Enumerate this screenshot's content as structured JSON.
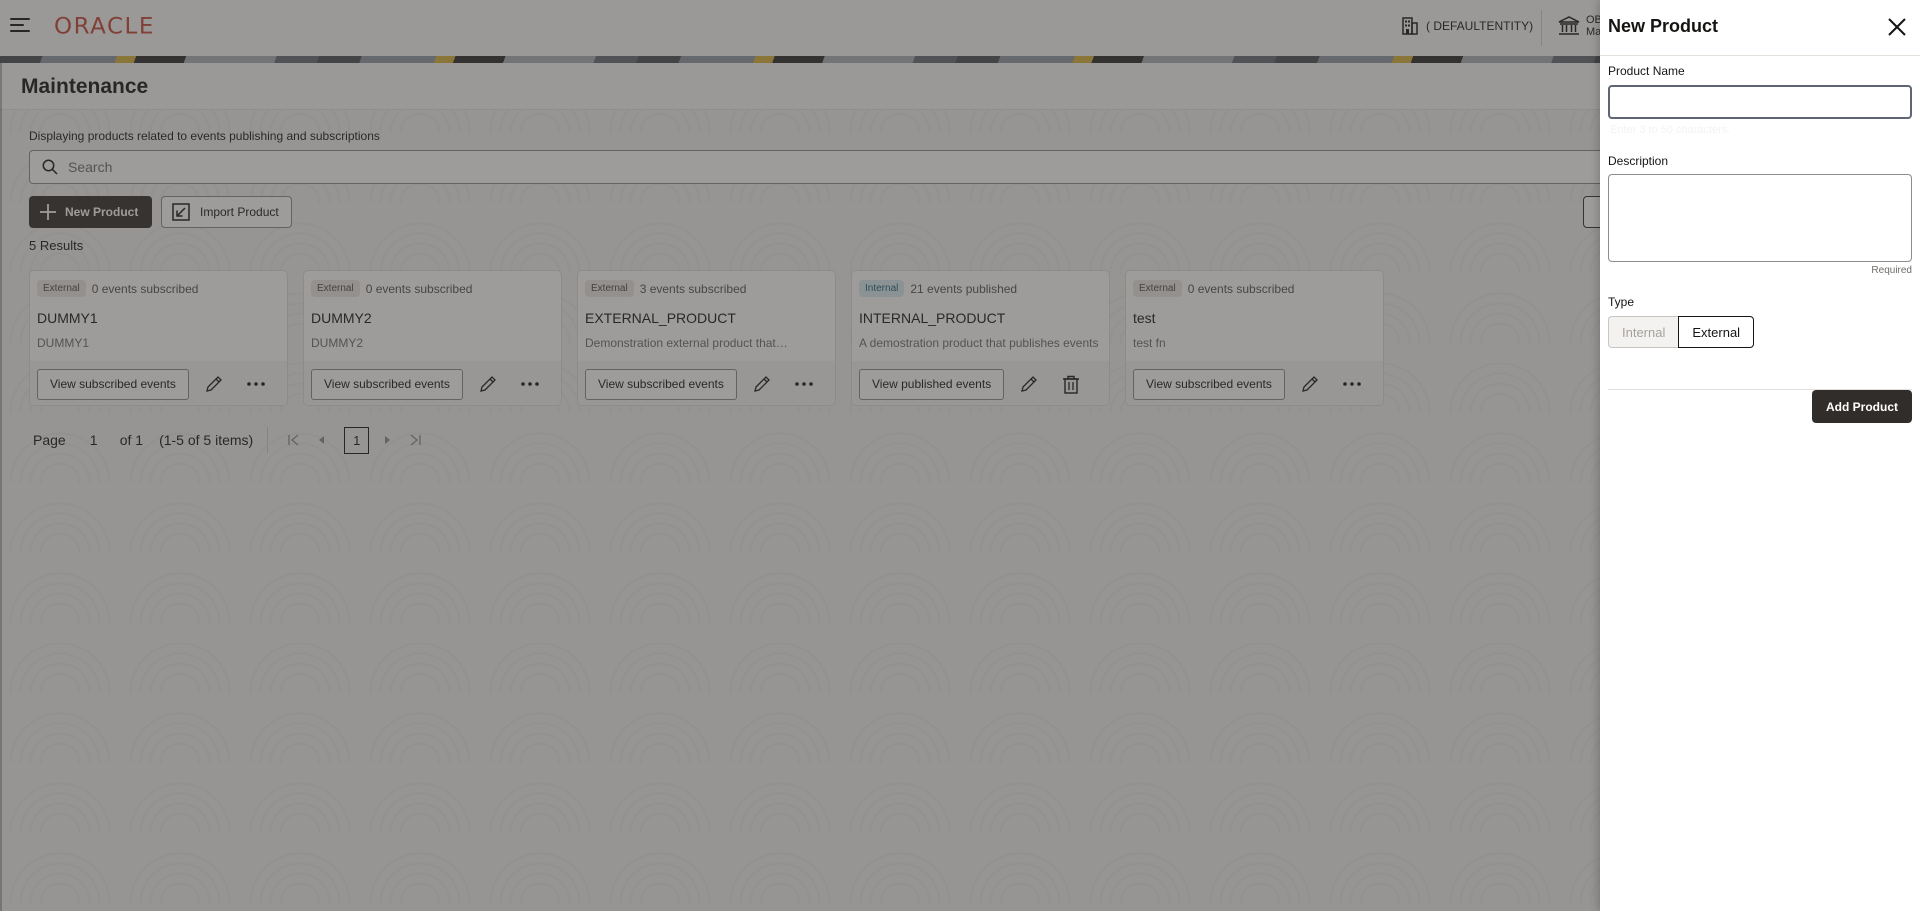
{
  "header": {
    "brand": "ORACLE",
    "entity": "( DEFAULTENTITY)",
    "bank_line1": "OB",
    "bank_line2": "Ma"
  },
  "page": {
    "title": "Maintenance",
    "subtitle": "Displaying products related to events publishing and subscriptions",
    "search_placeholder": "Search",
    "new_product_label": "New Product",
    "import_product_label": "Import Product",
    "results": "5 Results"
  },
  "cards": [
    {
      "type": "External",
      "type_key": "external",
      "meta": "0 events subscribed",
      "name": "DUMMY1",
      "description": "DUMMY1",
      "action": "View subscribed events",
      "secondary_icon": "more"
    },
    {
      "type": "External",
      "type_key": "external",
      "meta": "0 events subscribed",
      "name": "DUMMY2",
      "description": "DUMMY2",
      "action": "View subscribed events",
      "secondary_icon": "more"
    },
    {
      "type": "External",
      "type_key": "external",
      "meta": "3 events subscribed",
      "name": "EXTERNAL_PRODUCT",
      "description": "Demonstration external product that…",
      "action": "View subscribed events",
      "secondary_icon": "more"
    },
    {
      "type": "Internal",
      "type_key": "internal",
      "meta": "21 events published",
      "name": "INTERNAL_PRODUCT",
      "description": "A demostration product that publishes events",
      "action": "View published events",
      "secondary_icon": "delete"
    },
    {
      "type": "External",
      "type_key": "external",
      "meta": "0 events subscribed",
      "name": "test",
      "description": "test fn",
      "action": "View subscribed events",
      "secondary_icon": "more"
    }
  ],
  "pagination": {
    "page_label": "Page",
    "current_page": "1",
    "of_label": "of 1",
    "items_label": "(1-5 of 5 items)",
    "page_button": "1"
  },
  "drawer": {
    "title": "New Product",
    "product_name_label": "Product Name",
    "product_name_value": "",
    "product_name_helper": "Enter 3 to 50 characters.",
    "description_label": "Description",
    "description_value": "",
    "required_label": "Required",
    "type_label": "Type",
    "type_options": [
      "Internal",
      "External"
    ],
    "type_selected": "External",
    "submit_label": "Add Product"
  },
  "colors": {
    "brand": "#c74634",
    "primary_button": "#312d2a",
    "internal_tag_text": "#1d5f78"
  }
}
